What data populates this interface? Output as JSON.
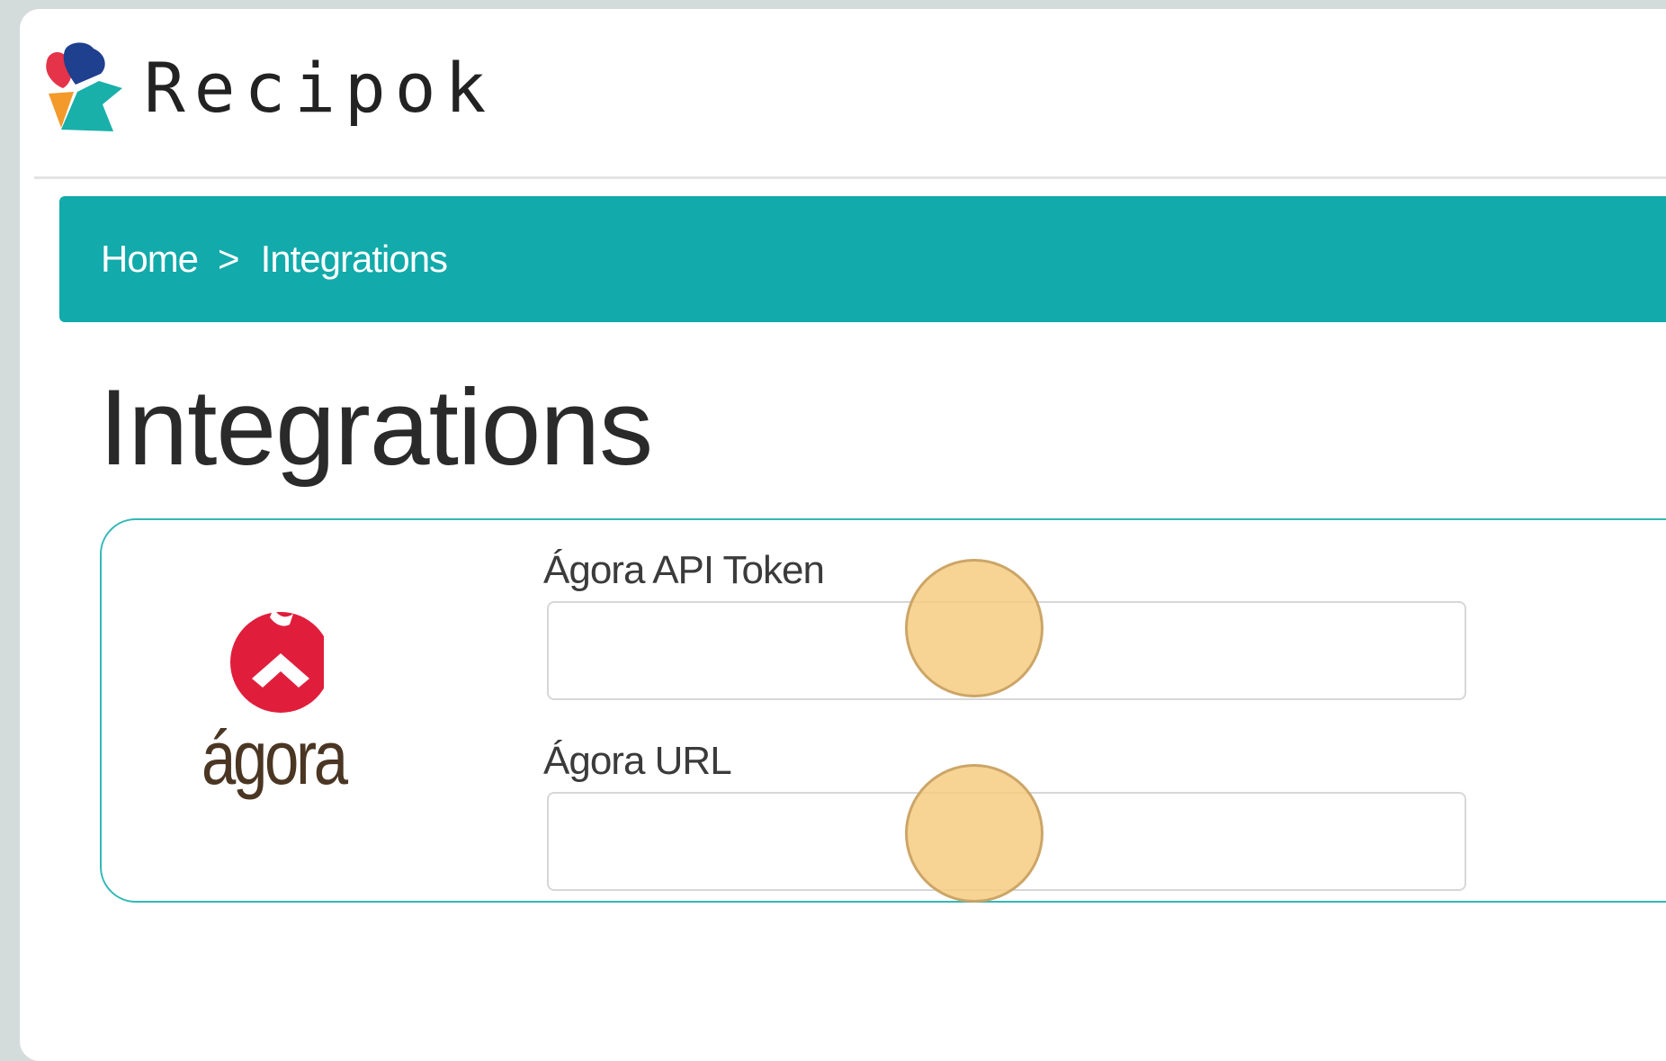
{
  "brand": {
    "name": "Recipok",
    "colors": {
      "red": "#e5334a",
      "blue": "#1f3f8f",
      "orange": "#f39a2b",
      "teal": "#19b0aa"
    }
  },
  "breadcrumb": {
    "home": "Home",
    "separator": ">",
    "current": "Integrations",
    "background": "#12aaaa"
  },
  "page": {
    "title": "Integrations"
  },
  "integration": {
    "provider_logo_text": "ágora",
    "fields": [
      {
        "label": "Ágora API Token",
        "value": "",
        "placeholder": ""
      },
      {
        "label": "Ágora URL",
        "value": "",
        "placeholder": ""
      }
    ]
  },
  "icons": {
    "app_logo": "recipok-logo-icon",
    "provider_logo": "agora-logo-icon"
  }
}
